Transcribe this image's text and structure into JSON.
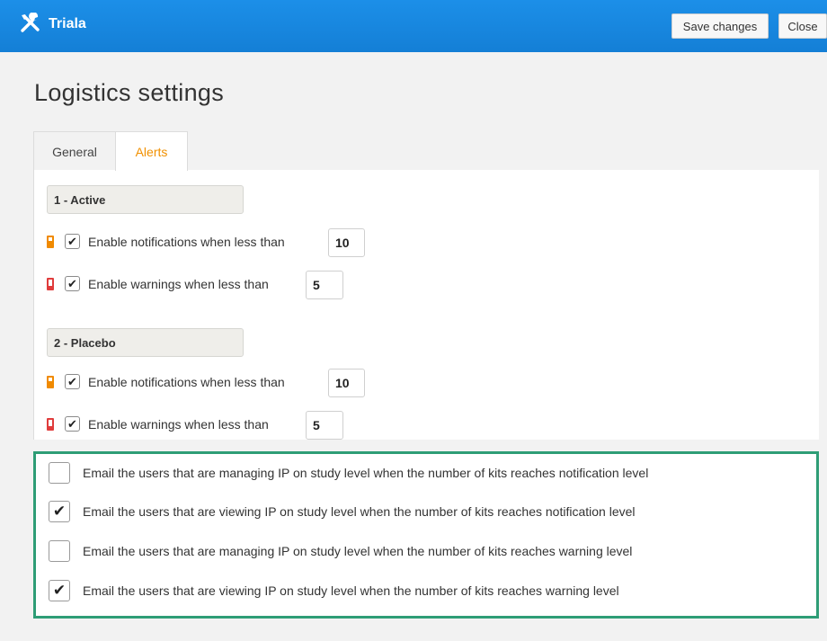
{
  "app": {
    "name": "Triala",
    "icon": "tools-icon"
  },
  "toolbar": {
    "save_label": "Save changes",
    "close_label": "Close"
  },
  "page": {
    "title": "Logistics settings"
  },
  "tabs": [
    {
      "label": "General",
      "active": false
    },
    {
      "label": "Alerts",
      "active": true
    }
  ],
  "groups": [
    {
      "name": "1 - Active",
      "notification": {
        "label": "Enable notifications when less than",
        "checked": true,
        "value": "10",
        "icon": "level-notification-icon"
      },
      "warning": {
        "label": "Enable warnings when less than",
        "checked": true,
        "value": "5",
        "icon": "level-warning-icon"
      }
    },
    {
      "name": "2 - Placebo",
      "notification": {
        "label": "Enable notifications when less than",
        "checked": true,
        "value": "10",
        "icon": "level-notification-icon"
      },
      "warning": {
        "label": "Enable warnings when less than",
        "checked": true,
        "value": "5",
        "icon": "level-warning-icon"
      }
    }
  ],
  "email_options": [
    {
      "label": "Email the users that are managing IP on study level when the number of kits reaches notification level",
      "checked": false
    },
    {
      "label": "Email the users that are viewing IP on study level when the number of kits reaches notification level",
      "checked": true
    },
    {
      "label": "Email the users that are managing IP on study level when the number of kits reaches warning level",
      "checked": false
    },
    {
      "label": "Email the users that are viewing IP on study level when the number of kits reaches warning level",
      "checked": true
    }
  ],
  "colors": {
    "topbar": "#1785de",
    "accent": "#f19000",
    "highlight_border": "#2e9d76",
    "warning": "#e03c3c"
  }
}
